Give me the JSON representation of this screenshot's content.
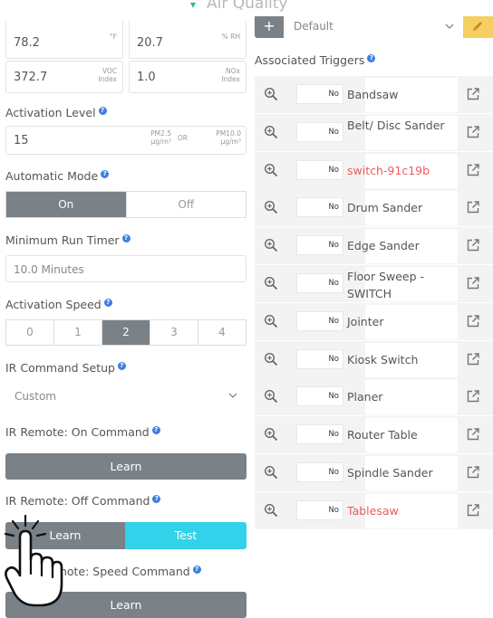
{
  "header": {
    "title": "Air Quality"
  },
  "readings": [
    {
      "value": "78.2",
      "unit": "°F"
    },
    {
      "value": "20.7",
      "unit": "% RH"
    },
    {
      "value": "372.7",
      "unit_line1": "VOC",
      "unit_line2": "Index"
    },
    {
      "value": "1.0",
      "unit_line1": "NOx",
      "unit_line2": "Index"
    }
  ],
  "activation_level": {
    "label": "Activation Level",
    "value": "15",
    "unit_a_line1": "PM2.5",
    "unit_a_line2": "µg/m³",
    "or": "OR",
    "unit_b_line1": "PM10.0",
    "unit_b_line2": "µg/m³"
  },
  "automatic_mode": {
    "label": "Automatic Mode",
    "on": "On",
    "off": "Off",
    "selected": "On"
  },
  "minimum_run_timer": {
    "label": "Minimum Run Timer",
    "value": "10.0 Minutes"
  },
  "activation_speed": {
    "label": "Activation Speed",
    "options": [
      "0",
      "1",
      "2",
      "3",
      "4"
    ],
    "selected": "2"
  },
  "ir_command_setup": {
    "label": "IR Command Setup",
    "value": "Custom"
  },
  "ir_on": {
    "label": "IR Remote: On Command",
    "learn": "Learn"
  },
  "ir_off": {
    "label": "IR Remote: Off Command",
    "learn": "Learn",
    "test": "Test"
  },
  "ir_speed": {
    "label": "IR Remote: Speed Command",
    "label_visible": "emote: Speed Command",
    "learn": "Learn"
  },
  "profile": {
    "add": "+",
    "value": "Default"
  },
  "associated_triggers": {
    "label": "Associated Triggers",
    "items": [
      {
        "no": "No",
        "name": "Bandsaw",
        "red": false
      },
      {
        "no": "No",
        "name": "Belt/ Disc Sander",
        "red": false
      },
      {
        "no": "No",
        "name": "switch-91c19b",
        "red": true
      },
      {
        "no": "No",
        "name": "Drum Sander",
        "red": false
      },
      {
        "no": "No",
        "name": "Edge Sander",
        "red": false
      },
      {
        "no": "No",
        "name": "Floor Sweep - SWITCH",
        "red": false
      },
      {
        "no": "No",
        "name": "Jointer",
        "red": false
      },
      {
        "no": "No",
        "name": "Kiosk Switch",
        "red": false
      },
      {
        "no": "No",
        "name": "Planer",
        "red": false
      },
      {
        "no": "No",
        "name": "Router Table",
        "red": false
      },
      {
        "no": "No",
        "name": "Spindle Sander",
        "red": false
      },
      {
        "no": "No",
        "name": "Tablesaw",
        "red": true
      }
    ]
  },
  "icons": {
    "zoom": "zoom-in-icon",
    "external": "external-link-icon",
    "help": "help-icon",
    "chevron": "chevron-down-icon",
    "pencil": "pencil-icon",
    "hand": "pointer-hand-icon"
  },
  "colors": {
    "accent": "#32d2ea",
    "gray_button": "#7a8187",
    "help": "#3d7fe0",
    "red_text": "#f05a5a",
    "pencil_bg": "#f4c542"
  }
}
